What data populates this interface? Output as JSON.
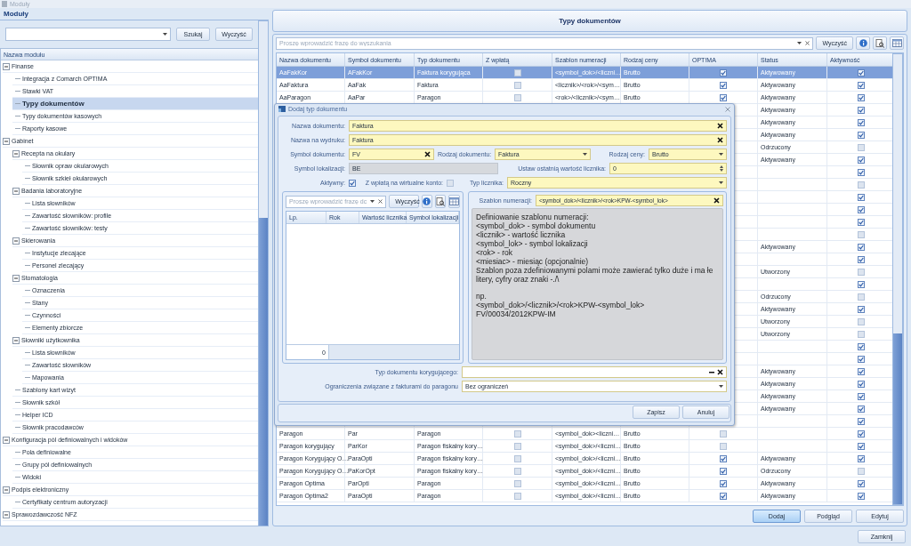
{
  "window": {
    "title": "Moduły"
  },
  "modules": {
    "title": "Moduły",
    "buttons": [
      "Szukaj",
      "Wyczyść"
    ],
    "tree_header": "Nazwa modułu",
    "tree": [
      {
        "label": "Finanse",
        "selected": false,
        "expanded": true,
        "children": [
          {
            "label": "Integracja z Comarch OPT!MA",
            "selected": false
          },
          {
            "label": "Stawki VAT",
            "selected": false
          },
          {
            "label": "Typy dokumentów",
            "selected": true
          },
          {
            "label": "Typy dokumentów kasowych",
            "selected": false
          },
          {
            "label": "Raporty kasowe",
            "selected": false
          }
        ]
      },
      {
        "label": "Gabinet",
        "selected": false,
        "expanded": true,
        "children": [
          {
            "label": "Recepta na okulary",
            "selected": false,
            "expanded": true,
            "children": [
              {
                "label": "Słownik opraw okularowych",
                "selected": false
              },
              {
                "label": "Słownik szkieł okularowych",
                "selected": false
              }
            ]
          },
          {
            "label": "Badania laboratoryjne",
            "selected": false,
            "expanded": true,
            "children": [
              {
                "label": "Lista słowników",
                "selected": false
              },
              {
                "label": "Zawartość słowników: profile",
                "selected": false
              },
              {
                "label": "Zawartość słowników: testy",
                "selected": false
              }
            ]
          },
          {
            "label": "Skierowania",
            "selected": false,
            "expanded": true,
            "children": [
              {
                "label": "Instytucje zlecające",
                "selected": false
              },
              {
                "label": "Personel zlecający",
                "selected": false
              }
            ]
          },
          {
            "label": "Stomatologia",
            "selected": false,
            "expanded": true,
            "children": [
              {
                "label": "Oznaczenia",
                "selected": false
              },
              {
                "label": "Stany",
                "selected": false
              },
              {
                "label": "Czynności",
                "selected": false
              },
              {
                "label": "Elementy zbiorcze",
                "selected": false
              }
            ]
          },
          {
            "label": "Słowniki użytkownika",
            "selected": false,
            "expanded": true,
            "children": [
              {
                "label": "Lista słowników",
                "selected": false
              },
              {
                "label": "Zawartość słowników",
                "selected": false
              },
              {
                "label": "Mapowania",
                "selected": false
              }
            ]
          },
          {
            "label": "Szablony kart wizyt",
            "selected": false
          },
          {
            "label": "Słownik szkół",
            "selected": false
          },
          {
            "label": "Helper ICD",
            "selected": false
          },
          {
            "label": "Słownik pracodawców",
            "selected": false
          }
        ]
      },
      {
        "label": "Konfiguracja pól definiowalnych i widoków",
        "selected": false,
        "expanded": true,
        "children": [
          {
            "label": "Pola definiowalne",
            "selected": false
          },
          {
            "label": "Grupy pól definiowalnych",
            "selected": false
          },
          {
            "label": "Widoki",
            "selected": false
          }
        ]
      },
      {
        "label": "Podpis elektroniczny",
        "selected": false,
        "expanded": true,
        "children": [
          {
            "label": "Certyfikaty centrum autoryzacji",
            "selected": false
          }
        ]
      },
      {
        "label": "Sprawozdawczość NFZ",
        "selected": false,
        "expanded": true
      }
    ]
  },
  "documents": {
    "title": "Typy dokumentów",
    "search": {
      "placeholder": "Proszę wprowadzić frazę do wyszukania"
    },
    "clear": "Wyczyść",
    "columns": [
      "Nazwa dokumentu",
      "Symbol dokumentu",
      "Typ dokumentu",
      "Z wpłatą",
      "Szablon numeracji",
      "Rodzaj ceny",
      "OPT!MA",
      "Status",
      "Aktywność"
    ],
    "rows": [
      {
        "selected": true,
        "name": "AaFakKor",
        "symbol": "AFakKor",
        "type": "Faktura korygująca",
        "paid": false,
        "template": "<symbol_dok>/<liczni…",
        "price": "Brutto",
        "optima": true,
        "status": "Aktywowany",
        "active": true
      },
      {
        "selected": false,
        "name": "AaFaktura",
        "symbol": "AaFak",
        "type": "Faktura",
        "paid": false,
        "template": "<licznik>/<rok>/<sym…",
        "price": "Brutto",
        "optima": true,
        "status": "Aktywowany",
        "active": true
      },
      {
        "selected": false,
        "name": "AaParagon",
        "symbol": "AaPar",
        "type": "Paragon",
        "paid": false,
        "template": "<rok>/<licznik>/<sym…",
        "price": "Brutto",
        "optima": true,
        "status": "Aktywowany",
        "active": true
      },
      {
        "selected": false,
        "status": "Aktywowany",
        "active": true
      },
      {
        "selected": false,
        "status": "Aktywowany",
        "active": true
      },
      {
        "selected": false,
        "status": "Aktywowany",
        "active": true
      },
      {
        "selected": false,
        "status": "Odrzucony",
        "active": false
      },
      {
        "selected": false,
        "status": "Aktywowany",
        "active": true
      },
      {
        "selected": false,
        "active": true
      },
      {
        "selected": false,
        "active": false
      },
      {
        "selected": false,
        "active": true
      },
      {
        "selected": false,
        "active": true
      },
      {
        "selected": false,
        "active": true
      },
      {
        "selected": false,
        "active": false
      },
      {
        "selected": false,
        "status": "Aktywowany",
        "active": true
      },
      {
        "selected": false,
        "active": true
      },
      {
        "selected": false,
        "status": "Utworzony",
        "active": false
      },
      {
        "selected": false,
        "active": true
      },
      {
        "selected": false,
        "status": "Odrzucony",
        "active": false
      },
      {
        "selected": false,
        "status": "Aktywowany",
        "active": true
      },
      {
        "selected": false,
        "status": "Utworzony",
        "active": false
      },
      {
        "selected": false,
        "status": "Utworzony",
        "active": false
      },
      {
        "selected": false,
        "active": true
      },
      {
        "selected": false,
        "active": true
      },
      {
        "selected": false,
        "status": "Aktywowany",
        "active": true
      },
      {
        "selected": false,
        "status": "Aktywowany",
        "active": true
      },
      {
        "selected": false,
        "status": "Aktywowany",
        "active": true
      },
      {
        "selected": false,
        "status": "Aktywowany",
        "active": true
      },
      {
        "selected": false,
        "active": true
      },
      {
        "selected": false,
        "name": "Paragon",
        "symbol": "Par",
        "type": "Paragon",
        "paid": false,
        "template": "<symbol_dok><liczni…",
        "price": "Brutto",
        "optima": false,
        "active": true
      },
      {
        "selected": false,
        "name": "Paragon korygujący",
        "symbol": "ParKor",
        "type": "Paragon fiskalny kory…",
        "paid": false,
        "template": "<symbol_dok>/<liczni…",
        "price": "Brutto",
        "optima": false,
        "active": true
      },
      {
        "selected": false,
        "name": "Paragon Korygujący O…",
        "symbol": "ParaOpti",
        "type": "Paragon fiskalny kory…",
        "paid": false,
        "template": "<symbol_dok>/<liczni…",
        "price": "Brutto",
        "optima": true,
        "status": "Aktywowany",
        "active": true
      },
      {
        "selected": false,
        "name": "Paragon Korygujący O…",
        "symbol": "PaKorOpt",
        "type": "Paragon fiskalny kory…",
        "paid": false,
        "template": "<symbol_dok>/<liczni…",
        "price": "Brutto",
        "optima": true,
        "status": "Odrzucony",
        "active": false
      },
      {
        "selected": false,
        "name": "Paragon Optima",
        "symbol": "ParOpti",
        "type": "Paragon",
        "paid": false,
        "template": "<symbol_dok>/<liczni…",
        "price": "Brutto",
        "optima": true,
        "status": "Aktywowany",
        "active": true
      },
      {
        "selected": false,
        "name": "Paragon Optima2",
        "symbol": "ParaOpti",
        "type": "Paragon",
        "paid": false,
        "template": "<symbol_dok>/<liczni…",
        "price": "Brutto",
        "optima": true,
        "status": "Aktywowany",
        "active": true
      }
    ],
    "buttons": [
      {
        "label": "Dodaj",
        "focused": true
      },
      {
        "label": "Podgląd",
        "focused": false
      },
      {
        "label": "Edytuj",
        "focused": false
      }
    ]
  },
  "dialog": {
    "title": "Dodaj typ dokumentu",
    "name": {
      "label": "Nazwa dokumentu:",
      "value": "Faktura"
    },
    "print_name": {
      "label": "Nazwa na wydruku:",
      "value": "Faktura"
    },
    "symbol": {
      "label": "Symbol dokumentu:",
      "value": "FV"
    },
    "doc_kind": {
      "label": "Rodzaj dokumentu:",
      "value": "Faktura"
    },
    "price_kind": {
      "label": "Rodzaj ceny:",
      "value": "Brutto"
    },
    "location_symbol": {
      "label": "Symbol lokalizacji:",
      "value": "BE",
      "disabled": true
    },
    "last_counter": {
      "label": "Ustaw ostatnią wartość licznika:",
      "value": "0"
    },
    "active": {
      "label": "Aktywny:",
      "checked": true
    },
    "virtual_account": {
      "label": "Z wpłatą na wirtualne konto:",
      "checked": false
    },
    "counter_type": {
      "label": "Typ licznika:",
      "value": "Roczny"
    },
    "counters": {
      "search": {
        "placeholder": "Proszę wprowadzić frazę dc"
      },
      "clear": "Wyczyść",
      "columns": [
        "Lp.",
        "Rok",
        "Wartość licznika",
        "Symbol lokalizacji"
      ],
      "footer": "0"
    },
    "template": {
      "label": "Szablon numeracji:",
      "value": "<symbol_dok>/<licznik>/<rok>KPW-<symbol_lok>",
      "help": [
        "Definiowanie szablonu numeracji:",
        "<symbol_dok> - symbol dokumentu",
        "<licznik> - wartość licznika",
        "<symbol_lok> - symbol lokalizacji",
        "<rok> - rok",
        "<miesiac> - miesiąc (opcjonalnie)",
        "Szablon poza zdefiniowanymi polami może zawierać tylko duże i ma łe litery, cyfry oraz znaki -./\\"
      ],
      "example": [
        "np.",
        "<symbol_dok>/<licznik>/<rok>KPW-<symbol_lok>",
        "FV/00034/2012KPW-IM"
      ]
    },
    "correction": {
      "label": "Typ dokumentu korygującego:"
    },
    "restrictions": {
      "label": "Ograniczenia związane z fakturami do paragonu",
      "value": "Bez ograniczeń"
    },
    "buttons": [
      "Zapisz",
      "Anuluj"
    ]
  },
  "close_button": "Zamknij"
}
